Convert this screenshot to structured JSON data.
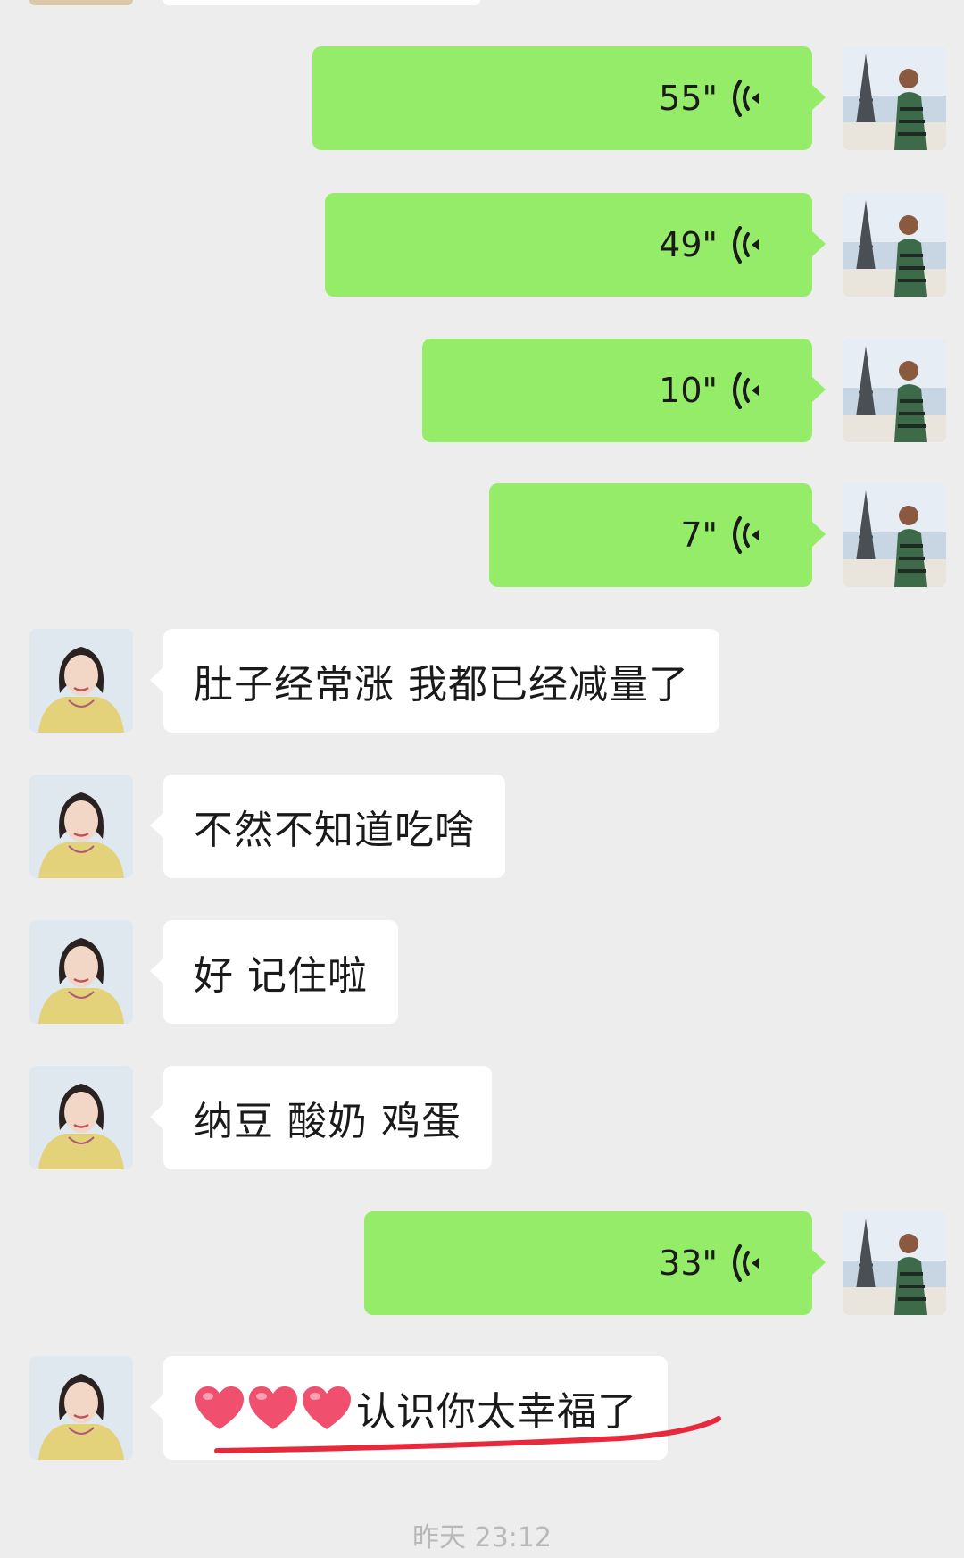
{
  "colors": {
    "background": "#ededed",
    "sent_bubble": "#95ec69",
    "received_bubble": "#ffffff",
    "text": "#1a1a1a",
    "underline": "#e8293b",
    "heart": "#f0506e"
  },
  "messages": [
    {
      "sender": "me",
      "kind": "voice",
      "duration": "55\""
    },
    {
      "sender": "me",
      "kind": "voice",
      "duration": "49\""
    },
    {
      "sender": "me",
      "kind": "voice",
      "duration": "10\""
    },
    {
      "sender": "me",
      "kind": "voice",
      "duration": "7\""
    },
    {
      "sender": "friend",
      "kind": "text",
      "text": "肚子经常涨 我都已经减量了"
    },
    {
      "sender": "friend",
      "kind": "text",
      "text": "不然不知道吃啥"
    },
    {
      "sender": "friend",
      "kind": "text",
      "text": "好 记住啦"
    },
    {
      "sender": "friend",
      "kind": "text",
      "text": "纳豆 酸奶 鸡蛋"
    },
    {
      "sender": "me",
      "kind": "voice",
      "duration": "33\""
    },
    {
      "sender": "friend",
      "kind": "text",
      "emoji_count": 3,
      "emoji_icon": "heart-icon",
      "text": "认识你太幸福了",
      "underlined": true
    }
  ],
  "timestamp": "昨天 23:12"
}
